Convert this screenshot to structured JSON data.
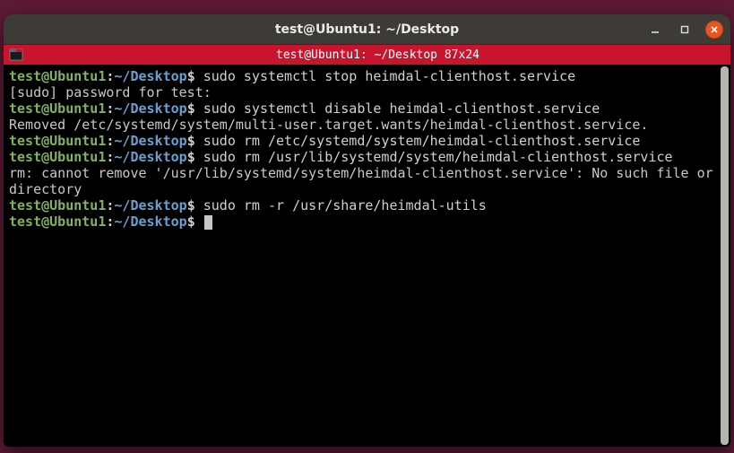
{
  "window": {
    "title": "test@Ubuntu1: ~/Desktop"
  },
  "tab": {
    "label": "test@Ubuntu1: ~/Desktop 87x24"
  },
  "prompt": {
    "userhost": "test@Ubuntu1",
    "colon": ":",
    "path": "~/Desktop",
    "dollar": "$"
  },
  "lines": {
    "cmd1": " sudo systemctl stop heimdal-clienthost.service",
    "out1": "[sudo] password for test:",
    "cmd2": " sudo systemctl disable heimdal-clienthost.service",
    "out2": "Removed /etc/systemd/system/multi-user.target.wants/heimdal-clienthost.service.",
    "cmd3": " sudo rm /etc/systemd/system/heimdal-clienthost.service",
    "cmd4": " sudo rm /usr/lib/systemd/system/heimdal-clienthost.service",
    "out4": "rm: cannot remove '/usr/lib/systemd/system/heimdal-clienthost.service': No such file or directory",
    "cmd5": " sudo rm -r /usr/share/heimdal-utils"
  }
}
